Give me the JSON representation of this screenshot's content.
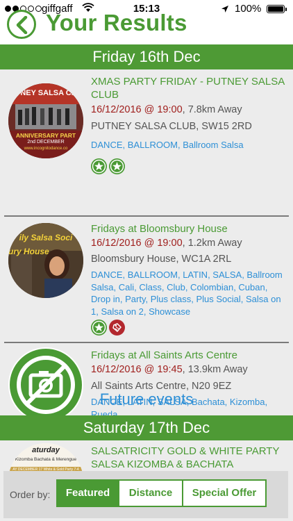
{
  "status_bar": {
    "carrier": "giffgaff",
    "time": "15:13",
    "battery": "100%",
    "signal_bars_filled": 2
  },
  "header": {
    "title": "Your Results",
    "back_icon": "chevron-left-icon"
  },
  "sections": [
    {
      "day": "Friday 16th Dec",
      "events": [
        {
          "title": "XMAS PARTY FRIDAY - PUTNEY SALSA CLUB",
          "datetime": "16/12/2016 @ 19:00",
          "distance": ", 7.8km Away",
          "venue": "PUTNEY SALSA CLUB, SW15 2RD",
          "tags": "DANCE, BALLROOM, Ballroom Salsa",
          "thumb_text_top": "UTNEY SALSA CLU",
          "thumb_text_mid": "ANNIVERSARY PART",
          "thumb_text_date": "2nd DECEMBER",
          "thumb_text_url": "www.incognitodance.co",
          "badges": [
            "star-icon",
            "star-icon"
          ]
        },
        {
          "title": "Fridays at Bloomsbury House",
          "datetime": "16/12/2016 @ 19:00",
          "distance": ", 1.2km Away",
          "venue": "Bloomsbury House, WC1A 2RL",
          "tags": "DANCE, BALLROOM, LATIN, SALSA, Ballroom Salsa, Cali, Class, Club, Colombian, Cuban, Drop in, Party, Plus class, Plus Social, Salsa on 1, Salsa on 2, Showcase",
          "thumb_text_top": "ily Salsa Soci",
          "thumb_text_mid": "ury House",
          "badges": [
            "star-icon",
            "tag-icon"
          ]
        },
        {
          "title": "Fridays at All Saints Arts Centre",
          "datetime": "16/12/2016 @ 19:45",
          "distance": ", 13.9km Away",
          "venue": "All Saints Arts Centre, N20 9EZ",
          "tags": "DANCE, LATIN, SALSA, Bachata, Kizomba, Rueda",
          "thumb_icon": "no-photo-icon",
          "badges": []
        }
      ]
    },
    {
      "heading_link": "Future events",
      "day": "Saturday 17th Dec",
      "events": [
        {
          "title": "SALSATRICITY GOLD & WHITE PARTY SALSA KIZOMBA & BACHATA",
          "thumb_text_top": "aturday",
          "thumb_text_mid": "Kizomba Bachata & Merengue",
          "thumb_text_low": "AY DECEMBER 17 White & Gold Party 7-4"
        }
      ]
    }
  ],
  "order_bar": {
    "label": "Order by:",
    "options": [
      "Featured",
      "Distance",
      "Special Offer"
    ],
    "selected": "Featured"
  },
  "colors": {
    "brand_green": "#4a9a34",
    "date_red": "#a0201e",
    "link_blue": "#2d8fd6",
    "list_bg": "#ececec"
  }
}
